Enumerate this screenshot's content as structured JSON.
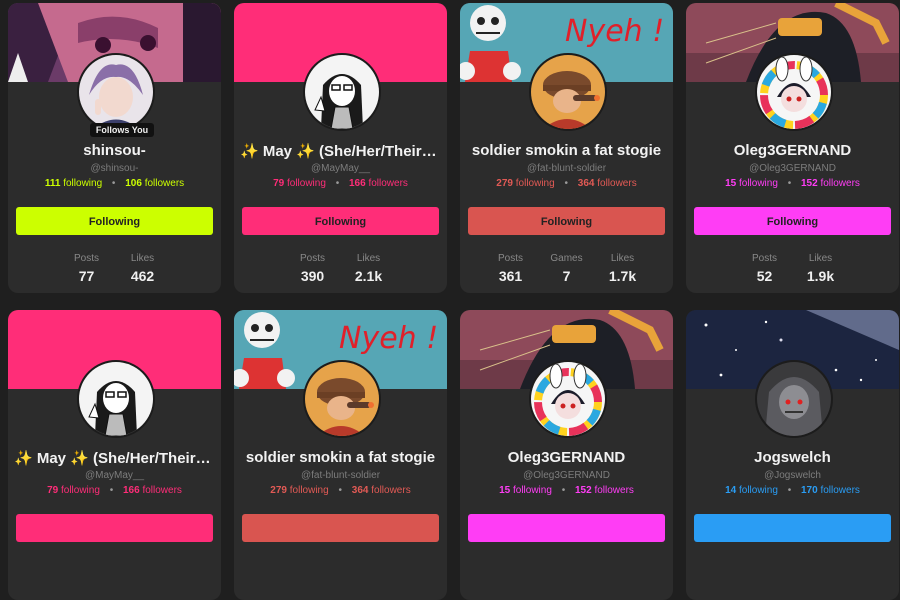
{
  "cards": [
    {
      "name": "shinsou-",
      "handle": "@shinsou-",
      "following_count": "111",
      "following_label": "following",
      "followers_count": "106",
      "followers_label": "followers",
      "badge": "Follows You",
      "button": "Following",
      "accent": "#ccff00",
      "banner": "anime",
      "avatar": "anime",
      "metrics": [
        {
          "label": "Posts",
          "value": "77"
        },
        {
          "label": "Likes",
          "value": "462"
        }
      ]
    },
    {
      "name": "✨ May ✨ (She/Her/Theirs…",
      "handle": "@MayMay__",
      "following_count": "79",
      "following_label": "following",
      "followers_count": "166",
      "followers_label": "followers",
      "button": "Following",
      "accent": "#ff2d78",
      "banner": "pink",
      "avatar": "sketch",
      "metrics": [
        {
          "label": "Posts",
          "value": "390"
        },
        {
          "label": "Likes",
          "value": "2.1k"
        }
      ]
    },
    {
      "name": "soldier smokin a fat stogie",
      "handle": "@fat-blunt-soldier",
      "following_count": "279",
      "following_label": "following",
      "followers_count": "364",
      "followers_label": "followers",
      "button": "Following",
      "accent": "#d95550",
      "banner": "nyeh",
      "banner_text": "Nyeh !",
      "avatar": "soldier",
      "metrics": [
        {
          "label": "Posts",
          "value": "361"
        },
        {
          "label": "Games",
          "value": "7"
        },
        {
          "label": "Likes",
          "value": "1.7k"
        }
      ]
    },
    {
      "name": "Oleg3GERNAND",
      "handle": "@Oleg3GERNAND",
      "following_count": "15",
      "following_label": "following",
      "followers_count": "152",
      "followers_label": "followers",
      "button": "Following",
      "accent": "#ff3df5",
      "banner": "dark",
      "avatar": "bunny",
      "metrics": [
        {
          "label": "Posts",
          "value": "52"
        },
        {
          "label": "Likes",
          "value": "1.9k"
        }
      ]
    },
    {
      "name": "✨ May ✨ (She/Her/Theirs…",
      "handle": "@MayMay__",
      "following_count": "79",
      "following_label": "following",
      "followers_count": "166",
      "followers_label": "followers",
      "accent": "#ff2d78",
      "banner": "pink",
      "avatar": "sketch"
    },
    {
      "name": "soldier smokin a fat stogie",
      "handle": "@fat-blunt-soldier",
      "following_count": "279",
      "following_label": "following",
      "followers_count": "364",
      "followers_label": "followers",
      "accent": "#d95550",
      "banner": "nyeh",
      "banner_text": "Nyeh !",
      "avatar": "soldier"
    },
    {
      "name": "Oleg3GERNAND",
      "handle": "@Oleg3GERNAND",
      "following_count": "15",
      "following_label": "following",
      "followers_count": "152",
      "followers_label": "followers",
      "accent": "#ff3df5",
      "banner": "dark",
      "avatar": "bunny"
    },
    {
      "name": "Jogswelch",
      "handle": "@Jogswelch",
      "following_count": "14",
      "following_label": "following",
      "followers_count": "170",
      "followers_label": "followers",
      "accent": "#2a9df4",
      "banner": "stars",
      "avatar": "hooded"
    }
  ]
}
